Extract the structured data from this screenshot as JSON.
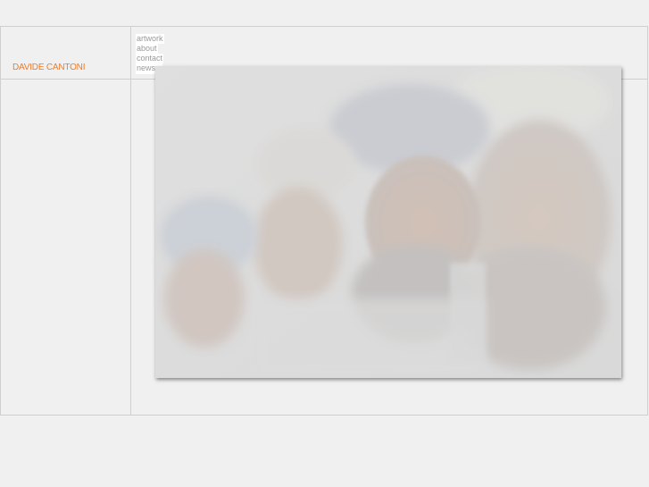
{
  "site": {
    "name": "DAVIDE CANTONI",
    "accent_color": "#f47a1f"
  },
  "nav": {
    "items": [
      {
        "label": "artwork"
      },
      {
        "label": "about"
      },
      {
        "label": "contact"
      },
      {
        "label": "news",
        "marker": "▸"
      }
    ]
  },
  "main": {
    "image": {
      "icon": "photo-of-men-in-turbans"
    }
  }
}
